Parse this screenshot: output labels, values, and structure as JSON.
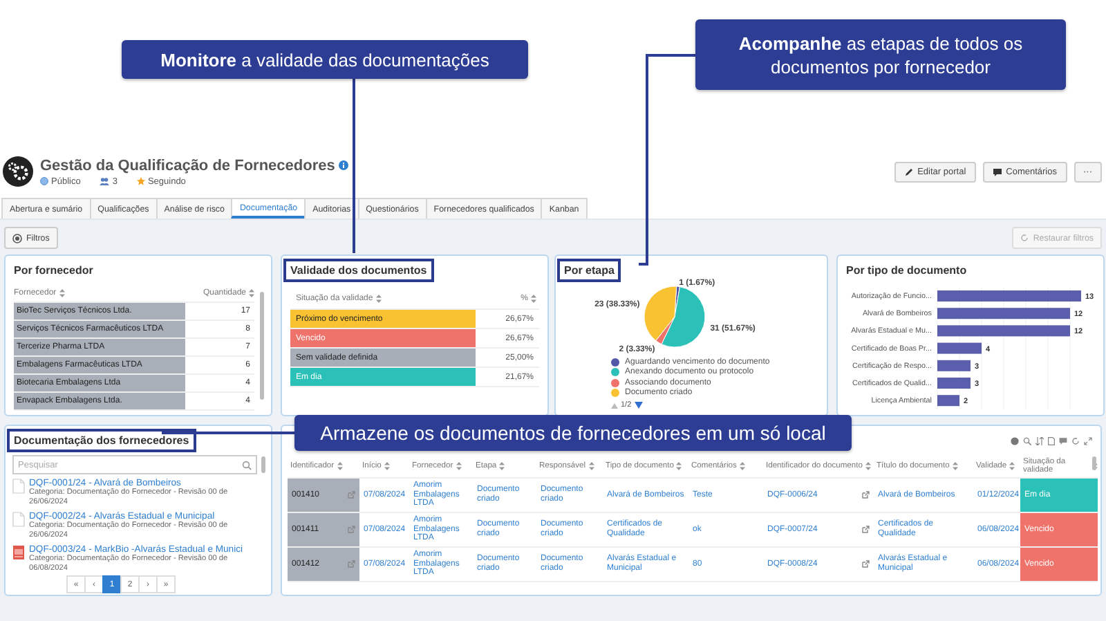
{
  "callouts": [
    {
      "text": "**Monitore** a validade das documentações"
    },
    {
      "text": "**Acompanhe** as etapas de todos os documentos por fornecedor"
    },
    {
      "text": "Armazene os documentos de fornecedores em um só local"
    }
  ],
  "portal": {
    "title": "Gestão da Qualificação de Fornecedores",
    "visibility": "Público",
    "members": "3",
    "follow": "Seguindo"
  },
  "actions": [
    {
      "label": "Editar portal",
      "kind": "edit"
    },
    {
      "label": "Comentários",
      "kind": "comment"
    },
    {
      "label": "···",
      "kind": "more"
    }
  ],
  "tabs": [
    {
      "label": "Abertura e sumário",
      "selected": false
    },
    {
      "label": "Qualificações",
      "selected": false
    },
    {
      "label": "Análise de risco",
      "selected": false
    },
    {
      "label": "Documentação",
      "selected": true
    },
    {
      "label": "Auditorias",
      "selected": false
    },
    {
      "label": "Questionários",
      "selected": false
    },
    {
      "label": "Fornecedores qualificados",
      "selected": false
    },
    {
      "label": "Kanban",
      "selected": false
    }
  ],
  "filters": {
    "button": "Filtros",
    "reset": {
      "label": "Restaurar filtros",
      "disabled": true
    }
  },
  "supplier_panel": {
    "title": "Por fornecedor",
    "highlighted": false,
    "columns": [
      "Fornecedor",
      "Quantidade"
    ],
    "rows": [
      {
        "name": "BioTec Serviços Técnicos Ltda.",
        "count": "17"
      },
      {
        "name": "Serviços Técnicos Farmacêuticos LTDA",
        "count": "8"
      },
      {
        "name": "Tercerize Pharma LTDA",
        "count": "7"
      },
      {
        "name": "Embalagens Farmacêuticas LTDA",
        "count": "6"
      },
      {
        "name": "Biotecaria Embalagens Ltda",
        "count": "4"
      },
      {
        "name": "Envapack Embalagens Ltda.",
        "count": "4"
      }
    ]
  },
  "validity_panel": {
    "title": "Validade dos documentos",
    "highlighted": true,
    "columns": [
      "Situação da validade",
      "%"
    ],
    "rows": [
      {
        "label": "Próximo do vencimento",
        "percent": "26,67%",
        "color": "#f8c232"
      },
      {
        "label": "Vencido",
        "percent": "26,67%",
        "color": "#ef726b"
      },
      {
        "label": "Sem validade definida",
        "percent": "25,00%",
        "color": "#a8aeb8"
      },
      {
        "label": "Em dia",
        "percent": "21,67%",
        "color": "#2bc1b8"
      }
    ]
  },
  "stage_panel": {
    "title": "Por etapa",
    "highlighted": true,
    "chart_data": {
      "type": "pie",
      "categories": [
        "Aguardando vencimento do documento",
        "Anexando documento ou protocolo",
        "Associando documento",
        "Documento criado"
      ],
      "values": [
        1,
        31,
        2,
        23
      ],
      "value_labels": [
        "1 (1.67%)",
        "31 (51.67%)",
        "2 (3.33%)",
        "23 (38.33%)"
      ]
    },
    "legend": [
      {
        "color": "#5458a8"
      },
      {
        "color": "#2bc1b8"
      },
      {
        "color": "#ef726b"
      },
      {
        "color": "#f8c232"
      }
    ],
    "legend_page": "1/2"
  },
  "doctype_panel": {
    "title": "Por tipo de documento",
    "highlighted": false,
    "chart_data": {
      "type": "bar",
      "orientation": "horizontal",
      "categories": [
        "Autorização de Funcio...",
        "Alvará de Bombeiros",
        "Alvarás Estadual e Mu...",
        "Certificado de Boas Pr...",
        "Certificação de Respo...",
        "Certificados de Qualid...",
        "Licença Ambiental"
      ],
      "values": [
        13,
        12,
        12,
        4,
        3,
        3,
        2
      ],
      "data_labels": true
    }
  },
  "docs_panel": {
    "title": "Documentação dos fornecedores",
    "highlighted": true,
    "search": {
      "placeholder": "Pesquisar"
    },
    "items": [
      {
        "kind": "file",
        "title": "DQF-0001/24 - Alvará de Bombeiros",
        "meta": "Categoria: Documentação do Fornecedor - Revisão 00 de 26/06/2024"
      },
      {
        "kind": "file",
        "title": "DQF-0002/24 - Alvarás Estadual e Municipal",
        "meta": "Categoria: Documentação do Fornecedor - Revisão 00 de 26/06/2024"
      },
      {
        "kind": "pdf",
        "title": "DQF-0003/24 - MarkBio -Alvarás Estadual e Munici",
        "meta": "Categoria: Documentação do Fornecedor - Revisão 00 de 06/08/2024"
      }
    ],
    "pager": [
      {
        "label": "«",
        "selected": false
      },
      {
        "label": "‹",
        "selected": false
      },
      {
        "label": "1",
        "selected": true
      },
      {
        "label": "2",
        "selected": false
      },
      {
        "label": "›",
        "selected": false
      },
      {
        "label": "»",
        "selected": false
      }
    ]
  },
  "table_panel": {
    "columns": [
      "Identificador",
      "Início",
      "Fornecedor",
      "Etapa",
      "Responsável",
      "Tipo de documento",
      "Comentários",
      "Identificador do documento",
      "Título do documento",
      "Validade",
      "Situação da validade"
    ],
    "rows": [
      {
        "cells": [
          "001410",
          "07/08/2024",
          "Amorim Embalagens LTDA",
          "Documento criado",
          "Documento criado",
          "Alvará de Bombeiros",
          "Teste",
          "DQF-0006/24",
          "Alvará de Bombeiros",
          "01/12/2024",
          "Em dia"
        ],
        "color": "#2bc1b8"
      },
      {
        "cells": [
          "001411",
          "07/08/2024",
          "Amorim Embalagens LTDA",
          "Documento criado",
          "Documento criado",
          "Certificados de Qualidade",
          "ok",
          "DQF-0007/24",
          "Certificados de Qualidade",
          "06/08/2024",
          "Vencido"
        ],
        "color": "#ef726b"
      },
      {
        "cells": [
          "001412",
          "07/08/2024",
          "Amorim Embalagens LTDA",
          "Documento criado",
          "Documento criado",
          "Alvarás Estadual e Municipal",
          "80",
          "DQF-0008/24",
          "Alvarás Estadual e Municipal",
          "06/08/2024",
          "Vencido"
        ],
        "color": "#ef726b"
      }
    ]
  }
}
